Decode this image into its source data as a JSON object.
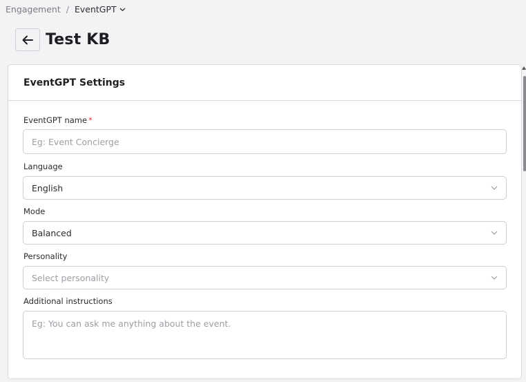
{
  "breadcrumb": {
    "parent": "Engagement",
    "separator": "/",
    "current": "EventGPT",
    "current_icon": "chevron-down-icon"
  },
  "header": {
    "back_icon": "arrow-left-icon",
    "title": "Test KB"
  },
  "settings": {
    "title": "EventGPT Settings",
    "name_field": {
      "label": "EventGPT name",
      "required_mark": "*",
      "value": "",
      "placeholder": "Eg: Event Concierge"
    },
    "language_field": {
      "label": "Language",
      "value": "English"
    },
    "mode_field": {
      "label": "Mode",
      "value": "Balanced"
    },
    "personality_field": {
      "label": "Personality",
      "value": "",
      "placeholder": "Select personality"
    },
    "instructions_field": {
      "label": "Additional instructions",
      "value": "",
      "placeholder": "Eg: You can ask me anything about the event."
    }
  },
  "colors": {
    "required": "#d9363e",
    "placeholder": "#9d9da5",
    "border": "#cdcdd4",
    "background": "#f3f3f5"
  }
}
